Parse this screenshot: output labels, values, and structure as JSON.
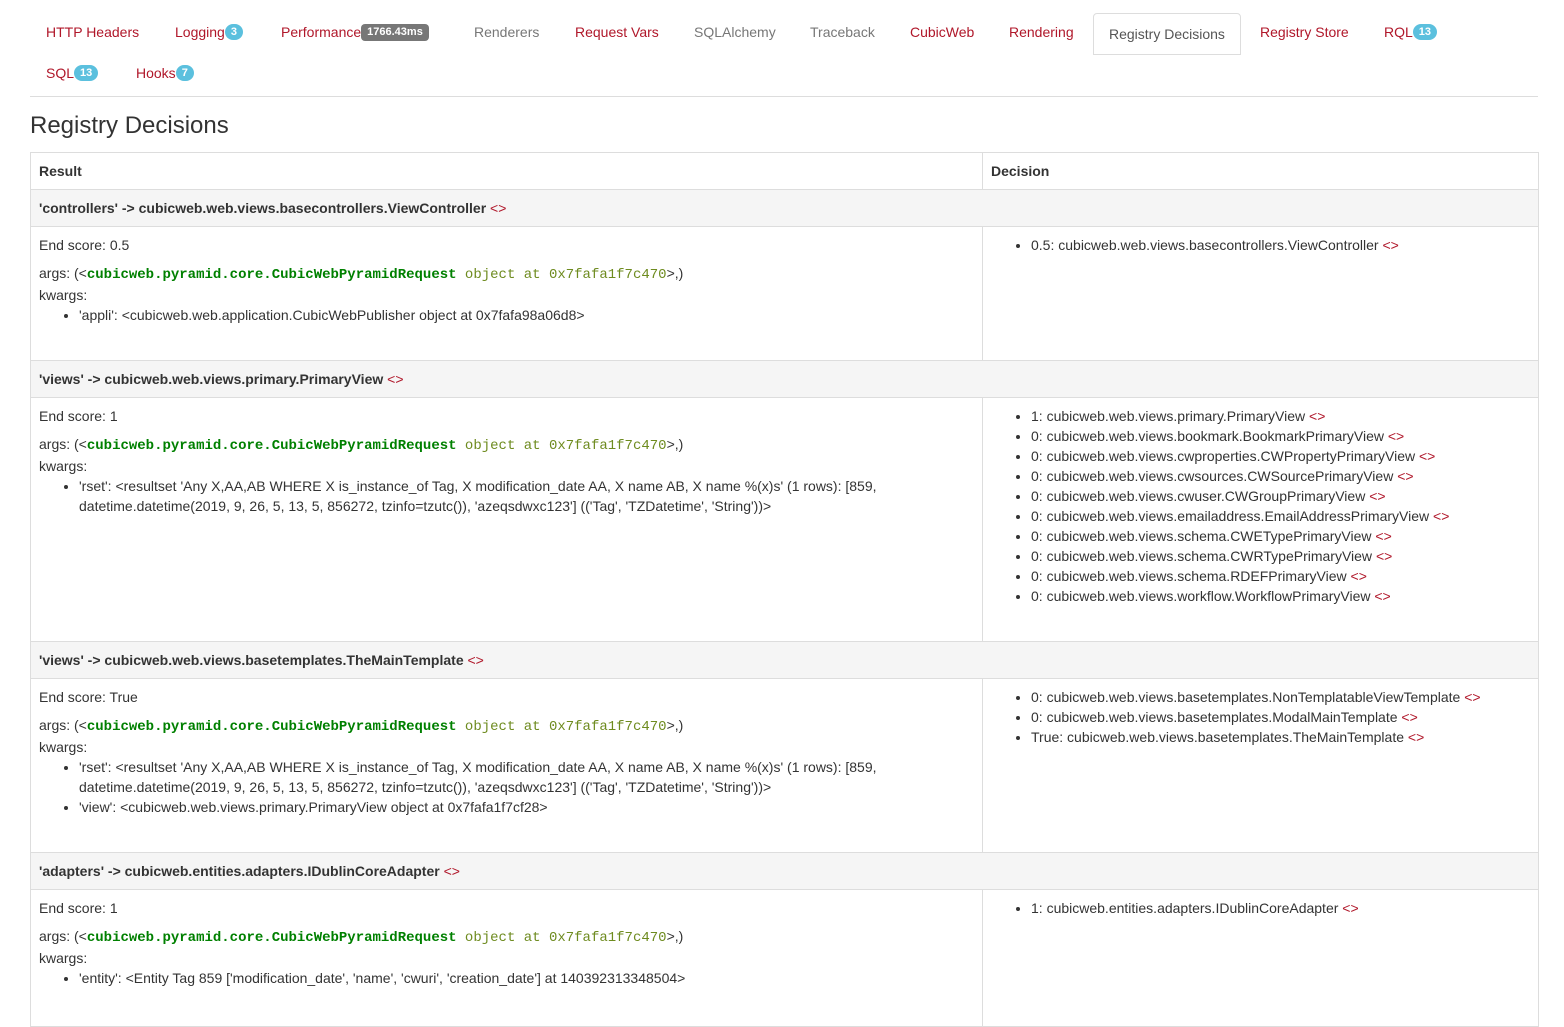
{
  "tabs": {
    "http_headers": "HTTP Headers",
    "logging": "Logging",
    "logging_count": "3",
    "performance": "Performance",
    "performance_time": "1766.43ms",
    "renderers": "Renderers",
    "request_vars": "Request Vars",
    "sqlalchemy": "SQLAlchemy",
    "traceback": "Traceback",
    "cubicweb": "CubicWeb",
    "rendering": "Rendering",
    "registry_decisions": "Registry Decisions",
    "registry_store": "Registry Store",
    "rql": "RQL",
    "rql_count": "13",
    "sql": "SQL",
    "sql_count": "13",
    "hooks": "Hooks",
    "hooks_count": "7"
  },
  "page_title": "Registry Decisions",
  "table": {
    "col_result": "Result",
    "col_decision": "Decision",
    "link_glyph": "<>",
    "args_prefix": "args: (<",
    "args_class": "cubicweb.pyramid.core.CubicWebPyramidRequest",
    "args_object": " object at 0x7fafa1f7c470",
    "args_suffix": ">,)",
    "kwargs_label": "kwargs:",
    "sections": [
      {
        "title": "'controllers' -> cubicweb.web.views.basecontrollers.ViewController",
        "end_score": "End score: 0.5",
        "kwargs": [
          "'appli': <cubicweb.web.application.CubicWebPublisher object at 0x7fafa98a06d8>"
        ],
        "decisions": [
          "0.5: cubicweb.web.views.basecontrollers.ViewController"
        ]
      },
      {
        "title": "'views' -> cubicweb.web.views.primary.PrimaryView",
        "end_score": "End score: 1",
        "kwargs": [
          "'rset': <resultset 'Any X,AA,AB WHERE X is_instance_of Tag, X modification_date AA, X name AB, X name %(x)s' (1 rows): [859, datetime.datetime(2019, 9, 26, 5, 13, 5, 856272, tzinfo=tzutc()), 'azeqsdwxc123'] (('Tag', 'TZDatetime', 'String'))>"
        ],
        "decisions": [
          "1: cubicweb.web.views.primary.PrimaryView",
          "0: cubicweb.web.views.bookmark.BookmarkPrimaryView",
          "0: cubicweb.web.views.cwproperties.CWPropertyPrimaryView",
          "0: cubicweb.web.views.cwsources.CWSourcePrimaryView",
          "0: cubicweb.web.views.cwuser.CWGroupPrimaryView",
          "0: cubicweb.web.views.emailaddress.EmailAddressPrimaryView",
          "0: cubicweb.web.views.schema.CWETypePrimaryView",
          "0: cubicweb.web.views.schema.CWRTypePrimaryView",
          "0: cubicweb.web.views.schema.RDEFPrimaryView",
          "0: cubicweb.web.views.workflow.WorkflowPrimaryView"
        ]
      },
      {
        "title": "'views' -> cubicweb.web.views.basetemplates.TheMainTemplate",
        "end_score": "End score: True",
        "kwargs": [
          "'rset': <resultset 'Any X,AA,AB WHERE X is_instance_of Tag, X modification_date AA, X name AB, X name %(x)s' (1 rows): [859, datetime.datetime(2019, 9, 26, 5, 13, 5, 856272, tzinfo=tzutc()), 'azeqsdwxc123'] (('Tag', 'TZDatetime', 'String'))>",
          "'view': <cubicweb.web.views.primary.PrimaryView object at 0x7fafa1f7cf28>"
        ],
        "decisions": [
          "0: cubicweb.web.views.basetemplates.NonTemplatableViewTemplate",
          "0: cubicweb.web.views.basetemplates.ModalMainTemplate",
          "True: cubicweb.web.views.basetemplates.TheMainTemplate"
        ]
      },
      {
        "title": "'adapters' -> cubicweb.entities.adapters.IDublinCoreAdapter",
        "end_score": "End score: 1",
        "kwargs": [
          "'entity': <Entity Tag 859 ['modification_date', 'name', 'cwuri', 'creation_date'] at 140392313348504>"
        ],
        "decisions": [
          "1: cubicweb.entities.adapters.IDublinCoreAdapter"
        ]
      }
    ]
  }
}
